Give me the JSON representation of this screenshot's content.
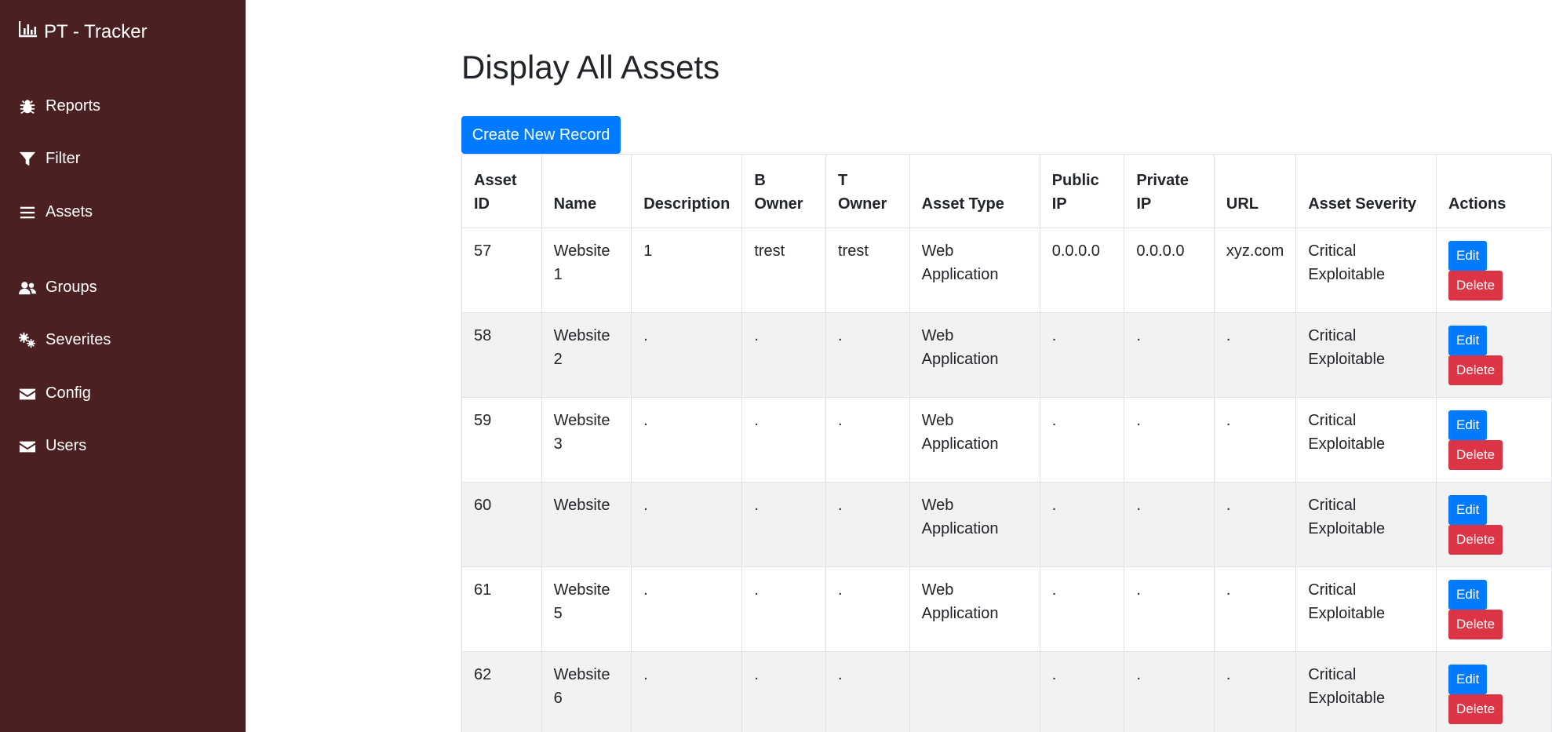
{
  "brand": {
    "title": "PT - Tracker",
    "icon": "bar-chart-icon"
  },
  "sidebar": {
    "items": [
      {
        "label": "Reports",
        "icon": "bug-icon"
      },
      {
        "label": "Filter",
        "icon": "filter-icon"
      },
      {
        "label": "Assets",
        "icon": "list-icon"
      },
      {
        "label": "Groups",
        "icon": "users-icon"
      },
      {
        "label": "Severites",
        "icon": "cogs-icon"
      },
      {
        "label": "Config",
        "icon": "envelope-icon"
      },
      {
        "label": "Users",
        "icon": "envelope-icon"
      }
    ]
  },
  "page": {
    "title": "Display All Assets",
    "create_label": "Create New Record"
  },
  "table": {
    "headers": [
      "Asset ID",
      "Name",
      "Description",
      "B Owner",
      "T Owner",
      "Asset Type",
      "Public IP",
      "Private IP",
      "URL",
      "Asset Severity",
      "Actions"
    ],
    "edit_label": "Edit",
    "delete_label": "Delete",
    "rows": [
      {
        "id": "57",
        "name": "Website 1",
        "description": "1",
        "b_owner": "trest",
        "t_owner": "trest",
        "asset_type": "Web Application",
        "public_ip": "0.0.0.0",
        "private_ip": "0.0.0.0",
        "url": "xyz.com",
        "severity": "Critical Exploitable"
      },
      {
        "id": "58",
        "name": "Website 2",
        "description": ".",
        "b_owner": ".",
        "t_owner": ".",
        "asset_type": "Web Application",
        "public_ip": ".",
        "private_ip": ".",
        "url": ".",
        "severity": "Critical Exploitable"
      },
      {
        "id": "59",
        "name": "Website 3",
        "description": ".",
        "b_owner": ".",
        "t_owner": ".",
        "asset_type": "Web Application",
        "public_ip": ".",
        "private_ip": ".",
        "url": ".",
        "severity": "Critical Exploitable"
      },
      {
        "id": "60",
        "name": "Website",
        "description": ".",
        "b_owner": ".",
        "t_owner": ".",
        "asset_type": "Web Application",
        "public_ip": ".",
        "private_ip": ".",
        "url": ".",
        "severity": "Critical Exploitable"
      },
      {
        "id": "61",
        "name": "Website 5",
        "description": ".",
        "b_owner": ".",
        "t_owner": ".",
        "asset_type": "Web Application",
        "public_ip": ".",
        "private_ip": ".",
        "url": ".",
        "severity": "Critical Exploitable"
      },
      {
        "id": "62",
        "name": "Website 6",
        "description": ".",
        "b_owner": ".",
        "t_owner": ".",
        "asset_type": "",
        "public_ip": ".",
        "private_ip": ".",
        "url": ".",
        "severity": "Critical Exploitable"
      }
    ]
  },
  "colors": {
    "sidebar": "#4a2020",
    "primary": "#007bff",
    "danger": "#dc3545"
  }
}
